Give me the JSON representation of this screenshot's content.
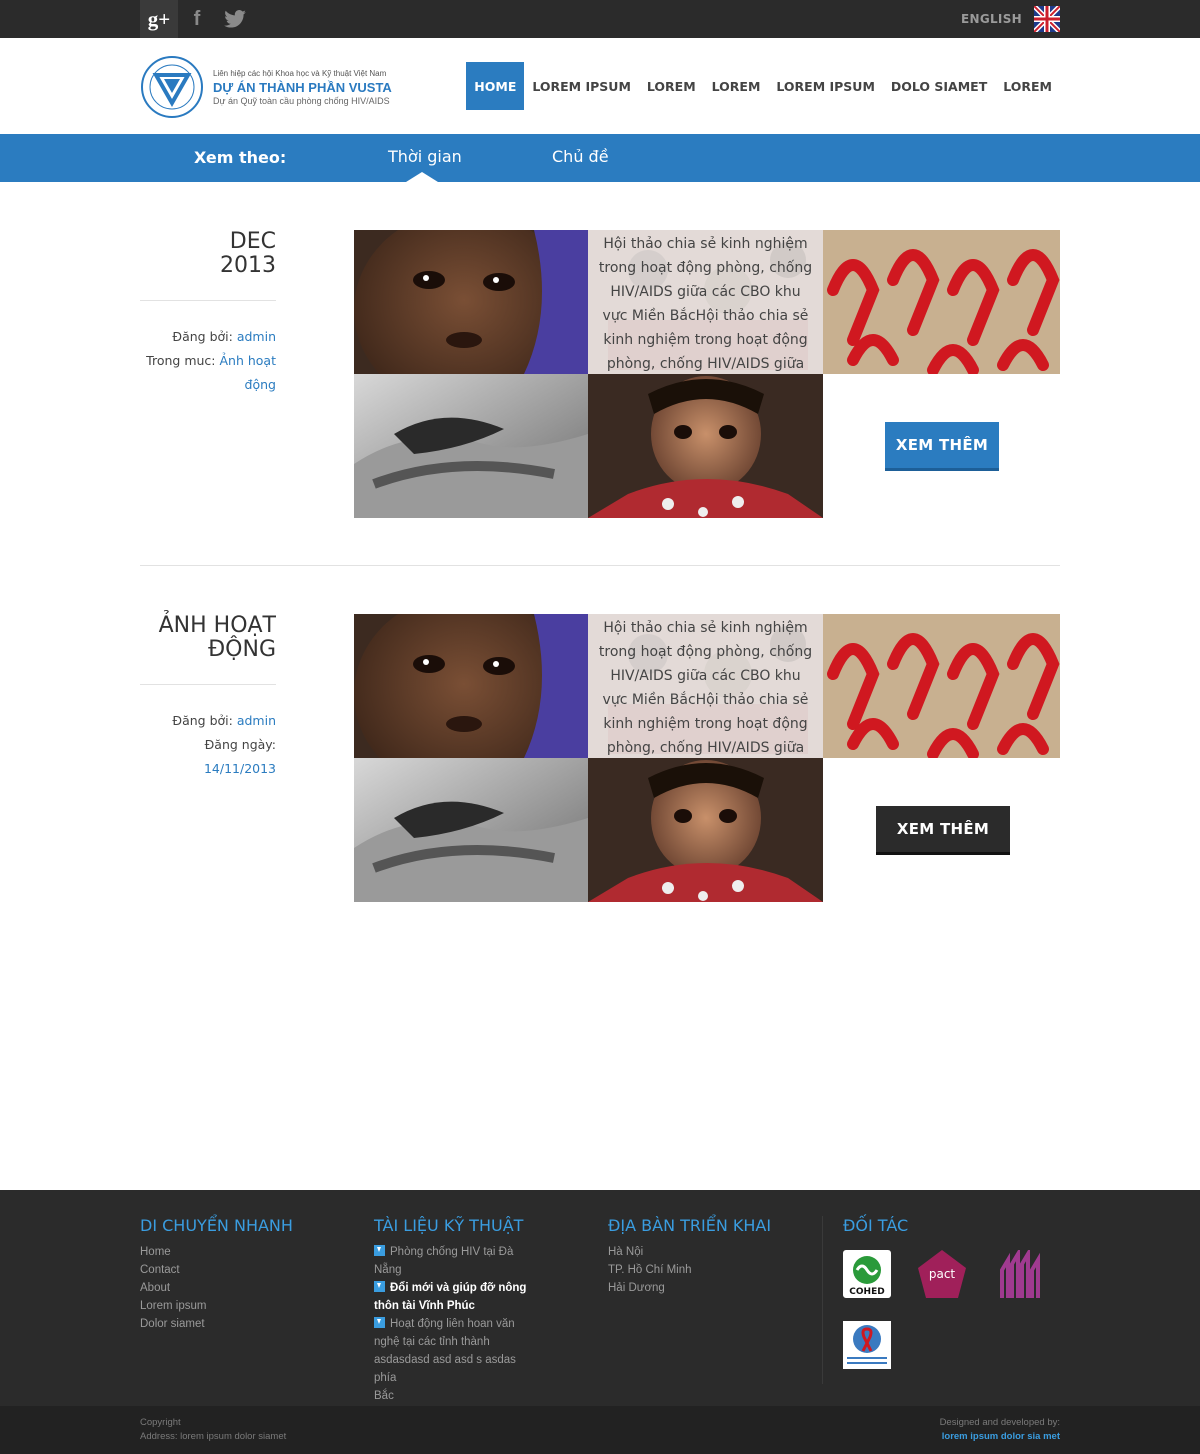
{
  "topbar": {
    "social": [
      {
        "name": "google-plus-icon",
        "glyph": "g+"
      },
      {
        "name": "facebook-icon",
        "glyph": "f"
      },
      {
        "name": "twitter-icon",
        "glyph": "t"
      }
    ],
    "language_label": "ENGLISH",
    "flag_icon": "uk-flag-icon"
  },
  "header": {
    "logo": {
      "line1": "Liên hiệp các hội Khoa học và Kỹ thuật Việt Nam",
      "line2": "DỰ ÁN THÀNH PHẦN VUSTA",
      "line3": "Dự án Quỹ toàn cầu phòng chống HIV/AIDS"
    },
    "nav": [
      "HOME",
      "LOREM IPSUM",
      "LOREM",
      "LOREM",
      "LOREM IPSUM",
      "DOLO SIAMET",
      "LOREM"
    ],
    "active_nav": "HOME"
  },
  "filter": {
    "label": "Xem theo:",
    "tabs": [
      "Thời gian",
      "Chủ đề"
    ],
    "active_tab": "Thời gian"
  },
  "posts": [
    {
      "title_line1": "DEC",
      "title_line2": "2013",
      "meta1_label": "Đăng bởi:",
      "meta1_value": "admin",
      "meta2_label": "Trong muc:",
      "meta2_value": "Ảnh hoạt động",
      "overlay_text": "Hội thảo chia sẻ kinh nghiệm trong hoạt động phòng, chống HIV/AIDS giữa các CBO khu vực Miền BắcHội thảo chia sẻ kinh nghiệm trong hoạt động phòng, chống HIV/AIDS giữa các CBO",
      "button": "XEM THÊM"
    },
    {
      "title_line1": "ẢNH HOẠT",
      "title_line2": "ĐỘNG",
      "meta1_label": "Đăng bởi:",
      "meta1_value": "admin",
      "meta2_label": "Đăng ngày:",
      "meta2_value": "14/11/2013",
      "overlay_text": "Hội thảo chia sẻ kinh nghiệm trong hoạt động phòng, chống HIV/AIDS giữa các CBO khu vực Miền BắcHội thảo chia sẻ kinh nghiệm trong hoạt động phòng, chống HIV/AIDS giữa các CBO",
      "button": "XEM THÊM"
    }
  ],
  "footer": {
    "col1": {
      "title": "DI CHUYỂN NHANH",
      "links": [
        "Home",
        "Contact",
        "About",
        "Lorem ipsum",
        "Dolor siamet"
      ]
    },
    "col2": {
      "title": "TÀI LIỆU KỸ THUẬT",
      "docs": [
        {
          "line1": "Phòng chống HIV tại Đà",
          "line2": "Nẵng"
        },
        {
          "line1": "Đổi mới và giúp đỡ nông",
          "line2": "thôn tài Vĩnh Phúc"
        },
        {
          "line1": "Hoạt động liên hoan văn",
          "line2": "nghệ tại các tỉnh thành",
          "line3": "asdasdasd asd asd s asdas phía",
          "line4": "Bắc"
        }
      ]
    },
    "col3": {
      "title": "ĐỊA BÀN TRIỂN KHAI",
      "links": [
        "Hà Nội",
        "TP. Hồ Chí Minh",
        "Hải Dương"
      ]
    },
    "col4": {
      "title": "ĐỐI TÁC",
      "partners": [
        "COHED",
        "pact",
        "ISDS",
        "Supported by the Global Fund"
      ]
    }
  },
  "bottom": {
    "copyright": "Copyright",
    "address": "Address: lorem ipsum dolor siamet",
    "designed": "Designed and developed by:",
    "designer": "lorem ipsum dolor sia met"
  },
  "colors": {
    "primary": "#2b7cc0",
    "dark": "#2b2b2b",
    "footer_title": "#3a9de0"
  }
}
